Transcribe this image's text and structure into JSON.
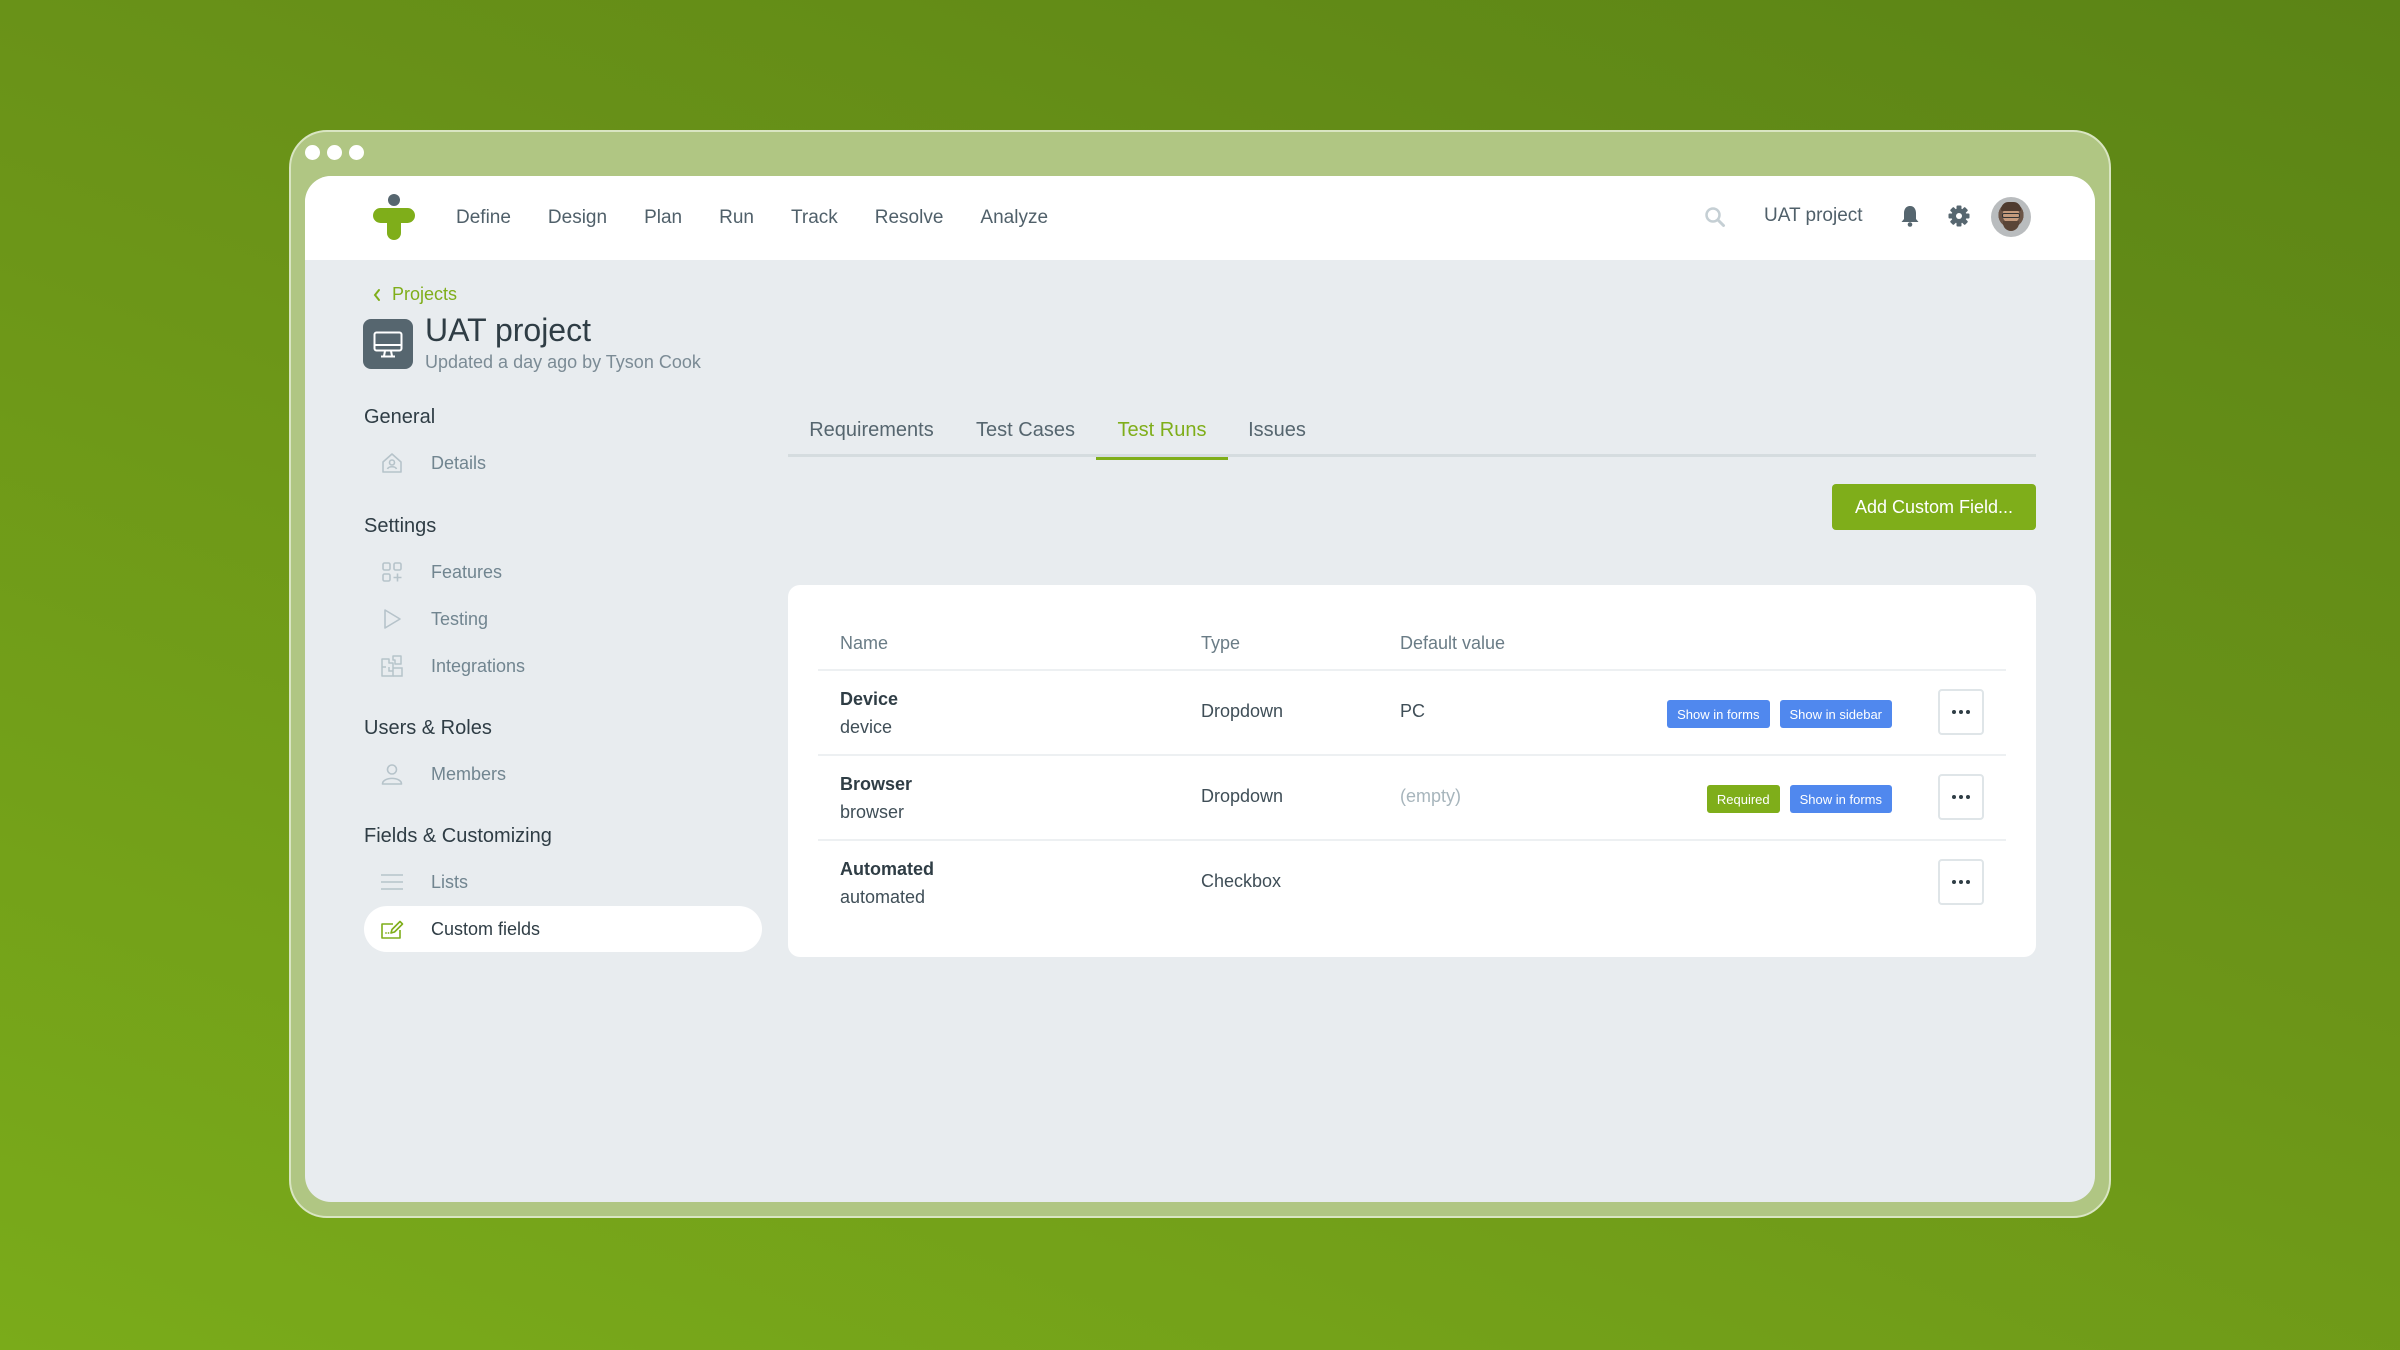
{
  "header": {
    "nav": [
      "Define",
      "Design",
      "Plan",
      "Run",
      "Track",
      "Resolve",
      "Analyze"
    ],
    "project_name": "UAT project",
    "icons": [
      "search-icon",
      "bell-icon",
      "gear-icon",
      "avatar"
    ]
  },
  "breadcrumb": {
    "label": "Projects"
  },
  "project": {
    "title": "UAT project",
    "subtitle": "Updated a day ago by Tyson Cook",
    "icon": "monitor-icon"
  },
  "sidebar": {
    "sections": [
      {
        "heading": "General",
        "items": [
          {
            "label": "Details",
            "icon": "home-user-icon"
          }
        ]
      },
      {
        "heading": "Settings",
        "items": [
          {
            "label": "Features",
            "icon": "grid-plus-icon"
          },
          {
            "label": "Testing",
            "icon": "play-icon"
          },
          {
            "label": "Integrations",
            "icon": "puzzle-icon"
          }
        ]
      },
      {
        "heading": "Users & Roles",
        "items": [
          {
            "label": "Members",
            "icon": "user-icon"
          }
        ]
      },
      {
        "heading": "Fields & Customizing",
        "items": [
          {
            "label": "Lists",
            "icon": "lines-icon"
          },
          {
            "label": "Custom fields",
            "icon": "edit-field-icon",
            "active": true
          }
        ]
      }
    ]
  },
  "tabs": [
    {
      "label": "Requirements",
      "active": false
    },
    {
      "label": "Test Cases",
      "active": false
    },
    {
      "label": "Test Runs",
      "active": true
    },
    {
      "label": "Issues",
      "active": false
    }
  ],
  "add_button": "Add Custom Field...",
  "table": {
    "columns": [
      "Name",
      "Type",
      "Default value"
    ],
    "rows": [
      {
        "name": "Device",
        "key": "device",
        "type": "Dropdown",
        "default": "PC",
        "badges": [
          {
            "label": "Show in forms",
            "color": "blue"
          },
          {
            "label": "Show in sidebar",
            "color": "blue"
          }
        ]
      },
      {
        "name": "Browser",
        "key": "browser",
        "type": "Dropdown",
        "default": "(empty)",
        "badges": [
          {
            "label": "Required",
            "color": "green"
          },
          {
            "label": "Show in forms",
            "color": "blue"
          }
        ]
      },
      {
        "name": "Automated",
        "key": "automated",
        "type": "Checkbox",
        "default": "",
        "badges": []
      }
    ]
  },
  "colors": {
    "accent": "#7fae1a",
    "badge_blue": "#5088ee",
    "text_dark": "#2f3d45",
    "text_muted": "#718590",
    "page_bg": "#e8ecef"
  }
}
